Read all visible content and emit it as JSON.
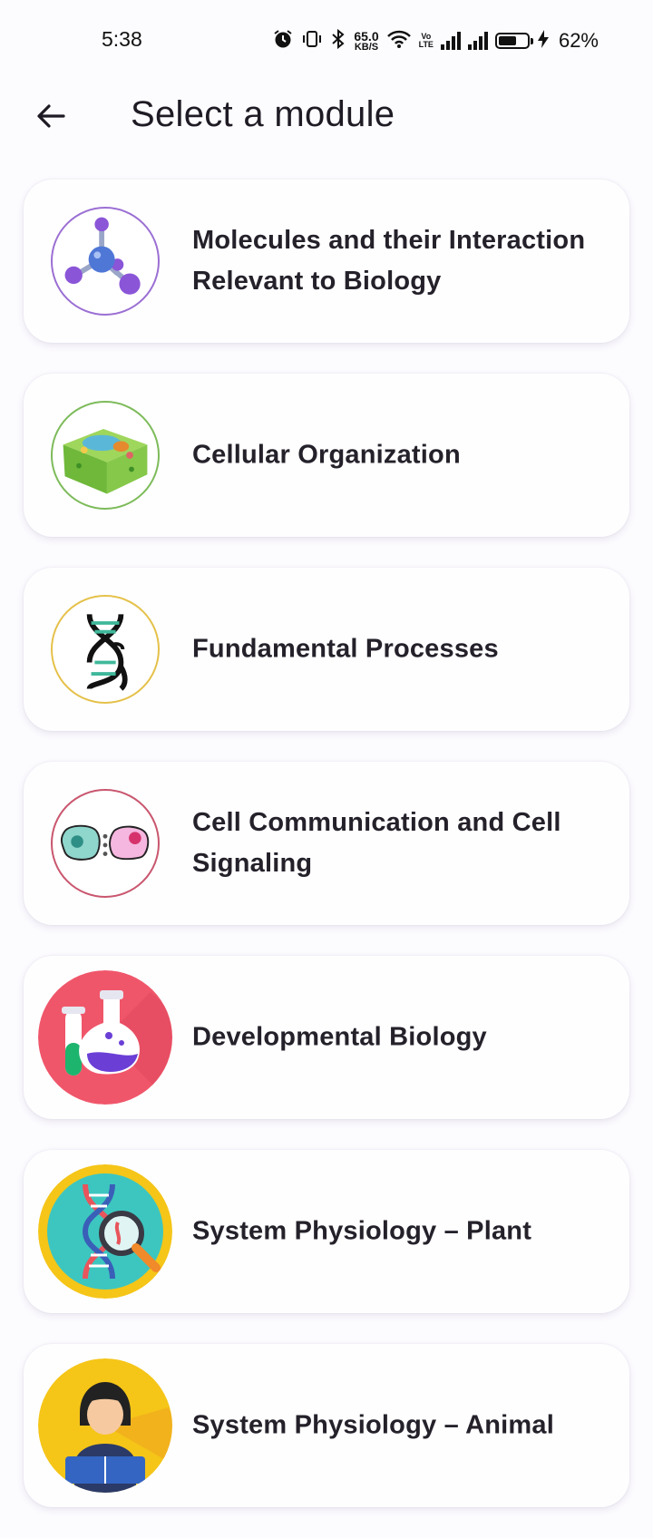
{
  "status_bar": {
    "time": "5:38",
    "speed_value": "65.0",
    "speed_unit": "KB/S",
    "volte_top": "Vo",
    "volte_bottom": "LTE",
    "battery_percent": "62%",
    "battery_level": 0.62,
    "icons": [
      "alarm-icon",
      "vibrate-icon",
      "bluetooth-icon",
      "wifi-icon",
      "volte-icon",
      "signal-icon",
      "signal-icon",
      "battery-icon",
      "charging-icon"
    ]
  },
  "app_bar": {
    "back_icon": "arrow-left-icon",
    "title": "Select a module"
  },
  "modules": [
    {
      "label": "Molecules and their Interaction Relevant to Biology",
      "icon": "molecule-icon",
      "ring_color": "#9b6fd3"
    },
    {
      "label": "Cellular Organization",
      "icon": "plant-cell-icon",
      "ring_color": "#7dbb5a"
    },
    {
      "label": "Fundamental Processes",
      "icon": "dna-icon",
      "ring_color": "#e5c14a"
    },
    {
      "label": "Cell Communication and Cell Signaling",
      "icon": "cell-signaling-icon",
      "ring_color": "#c9566e"
    },
    {
      "label": "Developmental Biology",
      "icon": "lab-flask-icon",
      "ring_color": "#f0566a"
    },
    {
      "label": "System Physiology – Plant",
      "icon": "dna-magnifier-icon",
      "ring_color": "#f5c518"
    },
    {
      "label": "System Physiology – Animal",
      "icon": "reader-person-icon",
      "ring_color": "#f5c518"
    }
  ]
}
